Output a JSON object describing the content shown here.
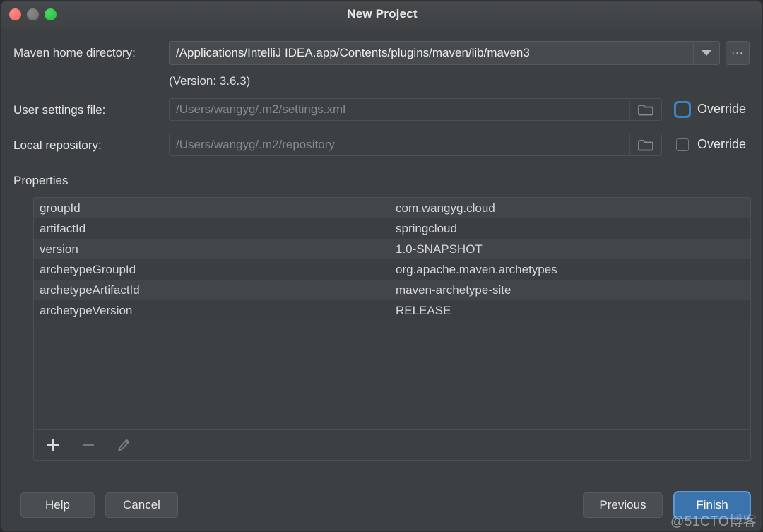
{
  "window": {
    "title": "New Project",
    "traffic_lights": [
      {
        "name": "close",
        "color": "#f4635a"
      },
      {
        "name": "minimize",
        "color": "#6b6b6b"
      },
      {
        "name": "maximize",
        "color": "#1fb93a"
      }
    ]
  },
  "form": {
    "maven_home": {
      "label": "Maven home directory:",
      "value": "/Applications/IntelliJ IDEA.app/Contents/plugins/maven/lib/maven3",
      "dropdown_icon": "chevron-down-icon",
      "browse_button_label": "...",
      "version_note": "(Version: 3.6.3)"
    },
    "user_settings": {
      "label": "User settings file:",
      "value": "/Users/wangyg/.m2/settings.xml",
      "folder_icon": "folder-icon",
      "override_label": "Override",
      "override_checked": false,
      "override_focused": true
    },
    "local_repository": {
      "label": "Local repository:",
      "value": "/Users/wangyg/.m2/repository",
      "folder_icon": "folder-icon",
      "override_label": "Override",
      "override_checked": false,
      "override_focused": false
    }
  },
  "properties": {
    "group_title": "Properties",
    "rows": [
      {
        "key": "groupId",
        "value": "com.wangyg.cloud"
      },
      {
        "key": "artifactId",
        "value": "springcloud"
      },
      {
        "key": "version",
        "value": "1.0-SNAPSHOT"
      },
      {
        "key": "archetypeGroupId",
        "value": "org.apache.maven.archetypes"
      },
      {
        "key": "archetypeArtifactId",
        "value": "maven-archetype-site"
      },
      {
        "key": "archetypeVersion",
        "value": "RELEASE"
      }
    ],
    "toolbar": {
      "add_icon": "plus-icon",
      "remove_icon": "minus-icon",
      "edit_icon": "pencil-icon",
      "add_enabled": true,
      "remove_enabled": false,
      "edit_enabled": false
    }
  },
  "footer": {
    "help_label": "Help",
    "cancel_label": "Cancel",
    "previous_label": "Previous",
    "finish_label": "Finish",
    "primary_button": "Finish"
  },
  "watermark": {
    "text": "@51CTO博客"
  },
  "colors": {
    "dialog_background": "#3c4043",
    "titlebar": "#434649",
    "accent_blue": "#3b73ad",
    "focus_ring": "#5b9ad6",
    "row_odd": "#42464a",
    "row_even": "#3b3f42",
    "text_primary": "#e3e4e5",
    "text_disabled": "#868b8e"
  }
}
